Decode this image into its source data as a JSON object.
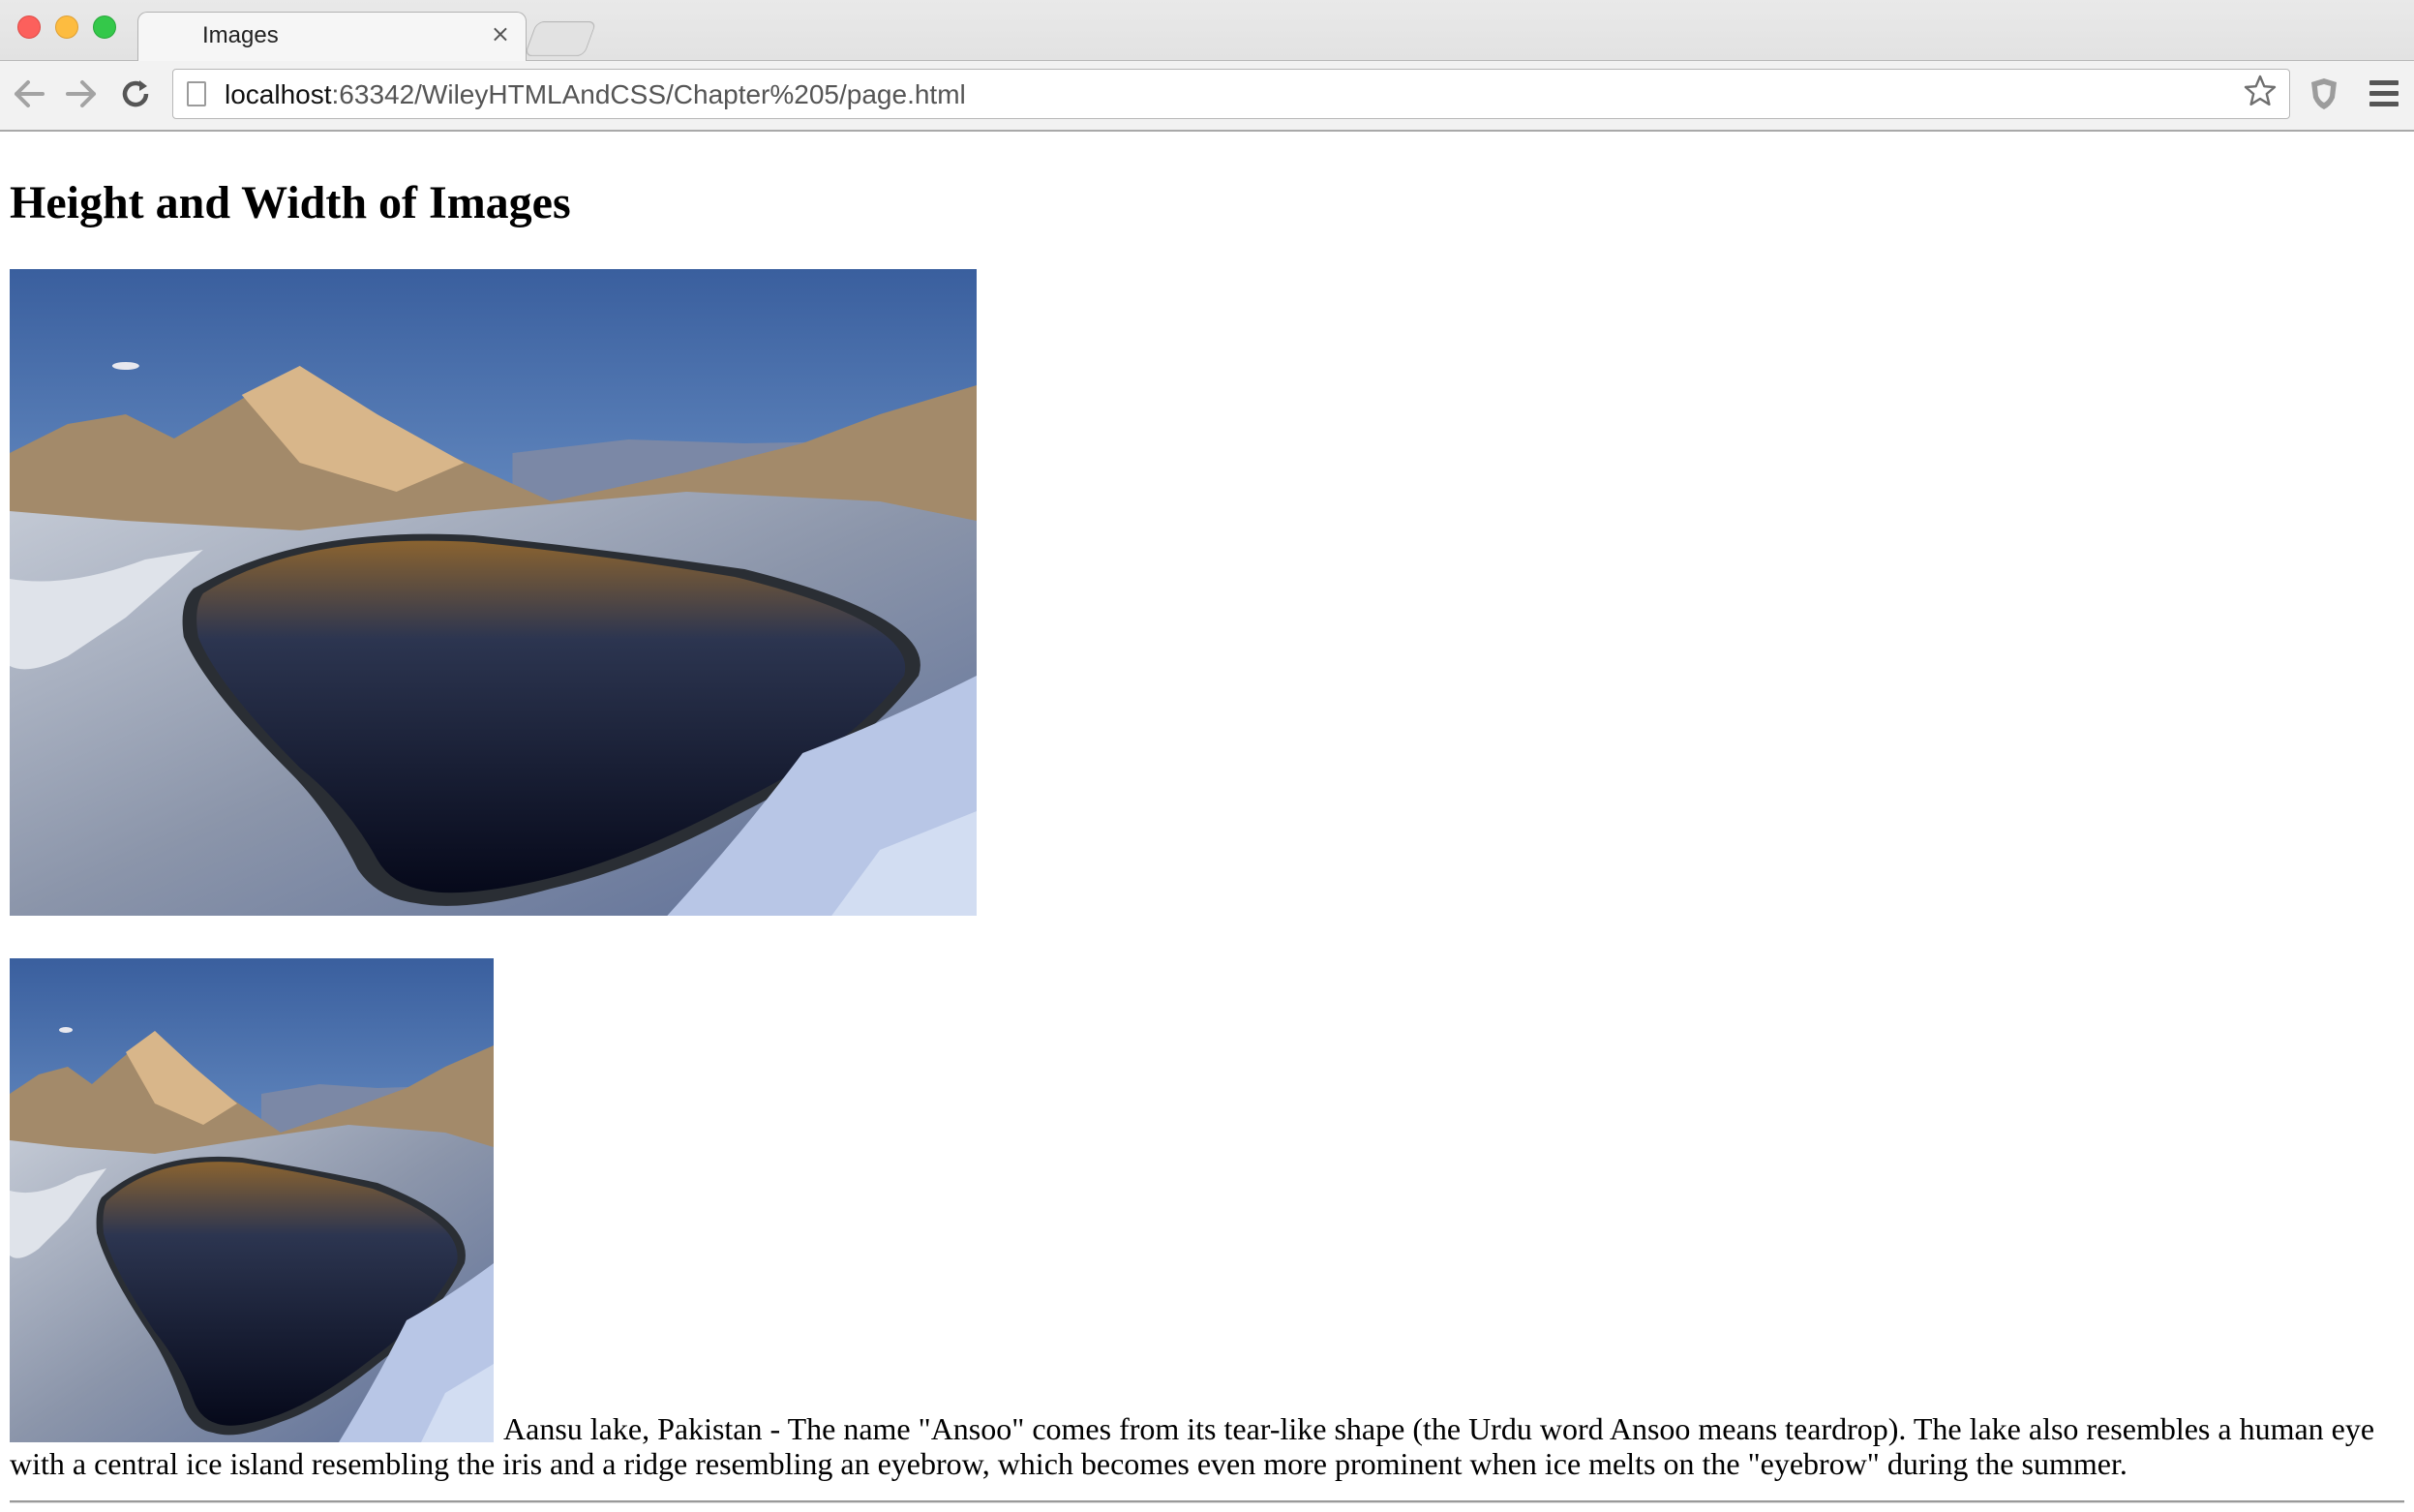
{
  "browser": {
    "tab_title": "Images",
    "tab_close": "×",
    "url_host": "localhost",
    "url_rest": ":63342/WileyHTMLAndCSS/Chapter%205/page.html"
  },
  "page": {
    "heading": "Height and Width of Images",
    "caption": "Aansu lake, Pakistan - The name \"Ansoo\" comes from its tear-like shape (the Urdu word Ansoo means teardrop). The lake also resembles a human eye with a central ice island resembling the iris and a ridge resembling an eyebrow, which becomes even more prominent when ice melts on the \"eyebrow\" during the summer."
  },
  "icons": {
    "back": "back-arrow-icon",
    "forward": "forward-arrow-icon",
    "reload": "reload-icon",
    "star": "bookmark-star-icon",
    "extension": "shield-extension-icon",
    "menu": "hamburger-menu-icon"
  }
}
